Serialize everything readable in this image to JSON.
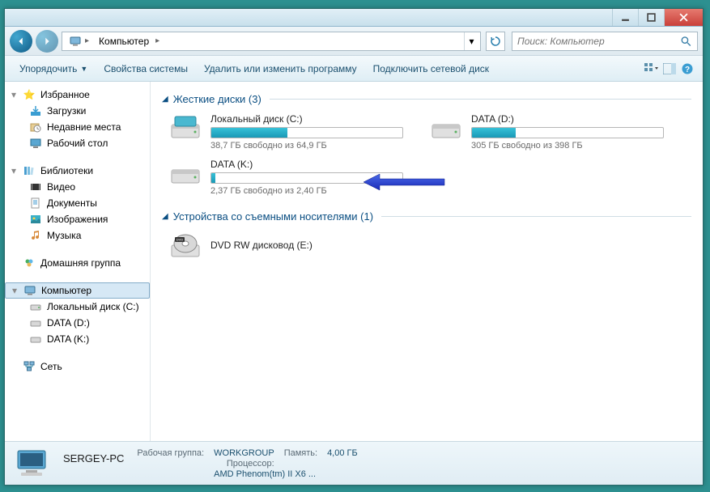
{
  "breadcrumb": {
    "computer": "Компьютер"
  },
  "search": {
    "placeholder": "Поиск: Компьютер"
  },
  "toolbar": {
    "organize": "Упорядочить",
    "properties": "Свойства системы",
    "uninstall": "Удалить или изменить программу",
    "mapdrive": "Подключить сетевой диск"
  },
  "sidebar": {
    "favorites": {
      "label": "Избранное",
      "items": [
        "Загрузки",
        "Недавние места",
        "Рабочий стол"
      ]
    },
    "libraries": {
      "label": "Библиотеки",
      "items": [
        "Видео",
        "Документы",
        "Изображения",
        "Музыка"
      ]
    },
    "homegroup": {
      "label": "Домашняя группа"
    },
    "computer": {
      "label": "Компьютер",
      "items": [
        "Локальный диск (C:)",
        "DATA (D:)",
        "DATA (K:)"
      ]
    },
    "network": {
      "label": "Сеть"
    }
  },
  "sections": {
    "hdd": {
      "title": "Жесткие диски (3)"
    },
    "removable": {
      "title": "Устройства со съемными носителями (1)"
    }
  },
  "drives": [
    {
      "name": "Локальный диск (C:)",
      "free": "38,7 ГБ свободно из 64,9 ГБ",
      "fill_pct": 40
    },
    {
      "name": "DATA (D:)",
      "free": "305 ГБ свободно из 398 ГБ",
      "fill_pct": 23
    },
    {
      "name": "DATA (K:)",
      "free": "2,37 ГБ свободно из 2,40 ГБ",
      "fill_pct": 2
    }
  ],
  "optical": {
    "name": "DVD RW дисковод (E:)"
  },
  "details": {
    "pcname": "SERGEY-PC",
    "workgroup_lbl": "Рабочая группа:",
    "workgroup": "WORKGROUP",
    "mem_lbl": "Память:",
    "mem": "4,00 ГБ",
    "cpu_lbl": "Процессор:",
    "cpu": "AMD Phenom(tm) II X6 ..."
  }
}
